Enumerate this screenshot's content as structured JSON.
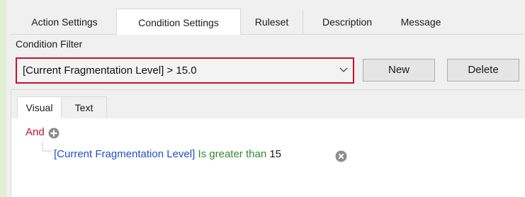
{
  "tabs": [
    {
      "label": "Action Settings"
    },
    {
      "label": "Condition Settings",
      "active": true
    },
    {
      "label": "Ruleset"
    },
    {
      "label": "Description"
    },
    {
      "label": "Message"
    }
  ],
  "condition_filter": {
    "label": "Condition Filter",
    "selected_value": "[Current Fragmentation Level] > 15.0",
    "new_button": "New",
    "delete_button": "Delete",
    "highlight_color": "#c8102e"
  },
  "view_tabs": [
    {
      "label": "Visual",
      "active": true
    },
    {
      "label": "Text"
    }
  ],
  "condition_tree": {
    "root_operator": "And",
    "conditions": [
      {
        "field": "[Current Fragmentation Level]",
        "operator": "Is greater than",
        "value": "15"
      }
    ]
  },
  "icons": {
    "add": "plus-circle-icon",
    "remove": "close-circle-icon",
    "dropdown": "chevron-down-icon"
  }
}
